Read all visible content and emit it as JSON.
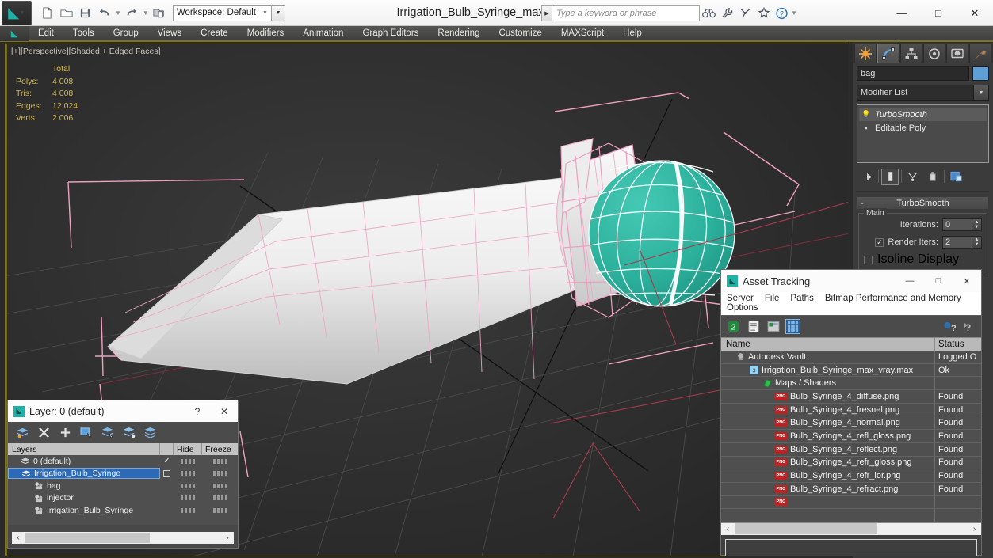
{
  "titlebar": {
    "app_logo": "3dsmax-logo-icon",
    "quick_access": [
      {
        "name": "new-file-icon",
        "glyph": "⬜"
      },
      {
        "name": "open-file-icon",
        "glyph": "🗁"
      },
      {
        "name": "save-file-icon",
        "glyph": "💾"
      },
      {
        "name": "undo-icon",
        "glyph": "↶"
      },
      {
        "name": "redo-icon",
        "glyph": "↷"
      },
      {
        "name": "project-folder-icon",
        "glyph": "🗂"
      }
    ],
    "workspace_label": "Workspace: Default",
    "document_title": "Irrigation_Bulb_Syringe_max_vray.max",
    "search_placeholder": "Type a keyword or phrase",
    "help_icons": [
      {
        "name": "binoculars-icon",
        "glyph": "🔍"
      },
      {
        "name": "wrench-icon",
        "glyph": "🔧"
      },
      {
        "name": "satellite-icon",
        "glyph": "📡"
      },
      {
        "name": "star-icon",
        "glyph": "★"
      },
      {
        "name": "help-circle-icon",
        "glyph": "?"
      }
    ],
    "window_controls": {
      "minimize": "—",
      "maximize": "□",
      "close": "✕"
    }
  },
  "menubar": {
    "items": [
      "Edit",
      "Tools",
      "Group",
      "Views",
      "Create",
      "Modifiers",
      "Animation",
      "Graph Editors",
      "Rendering",
      "Customize",
      "MAXScript",
      "Help"
    ]
  },
  "viewport": {
    "label": "[+][Perspective][Shaded + Edged Faces]",
    "stats": {
      "header": "Total",
      "rows": [
        {
          "label": "Polys:",
          "value": "4 008"
        },
        {
          "label": "Tris:",
          "value": "4 008"
        },
        {
          "label": "Edges:",
          "value": "12 024"
        },
        {
          "label": "Verts:",
          "value": "2 006"
        }
      ]
    },
    "colors": {
      "sphere": "#2fb5a0",
      "sphere_wire": "#ffffff",
      "body": "#e8e8e8",
      "selection_pink": "#ef9fc0",
      "grid": "#4a4a4a",
      "axis_black": "#111111",
      "axis_red": "#8e3044",
      "background": "#303030"
    }
  },
  "command_panel": {
    "tabs": [
      {
        "name": "create-tab",
        "glyph": "✦",
        "active": false
      },
      {
        "name": "modify-tab",
        "glyph": "◜",
        "active": true
      },
      {
        "name": "hierarchy-tab",
        "glyph": "⛓",
        "active": false
      },
      {
        "name": "motion-tab",
        "glyph": "◎",
        "active": false
      },
      {
        "name": "display-tab",
        "glyph": "▣",
        "active": false
      },
      {
        "name": "utilities-tab",
        "glyph": "🔨",
        "active": false
      }
    ],
    "object_name": "bag",
    "object_color": "#5f9fd8",
    "modifier_list_label": "Modifier List",
    "modifier_stack": [
      {
        "label": "TurboSmooth",
        "icon": "lightbulb-icon",
        "selected": true
      },
      {
        "label": "Editable Poly",
        "icon": "plus-box-icon",
        "selected": false
      }
    ],
    "stack_buttons": [
      {
        "name": "pin-stack-button",
        "glyph": "⚐"
      },
      {
        "name": "show-end-result-button",
        "glyph": "❙"
      },
      {
        "name": "make-unique-button",
        "glyph": "⑂"
      },
      {
        "name": "remove-modifier-button",
        "glyph": "⛃"
      },
      {
        "name": "configure-modifier-sets-button",
        "glyph": "▥"
      }
    ],
    "rollout": {
      "title": "TurboSmooth",
      "collapse_glyph": "-",
      "group_label": "Main",
      "iterations_label": "Iterations:",
      "iterations_value": "0",
      "render_iters_label": "Render Iters:",
      "render_iters_value": "2",
      "render_iters_checked": true,
      "isoline_label": "Isoline Display",
      "isoline_checked": false
    }
  },
  "asset_tracking": {
    "title": "Asset Tracking",
    "window_controls": {
      "minimize": "—",
      "maximize": "□",
      "close": "✕"
    },
    "menu": [
      "Server",
      "File",
      "Paths",
      "Bitmap Performance and Memory",
      "Options"
    ],
    "toolbar": [
      {
        "name": "vault-refresh-icon",
        "glyph": "↻",
        "active": false
      },
      {
        "name": "list-view-icon",
        "glyph": "☰",
        "active": false
      },
      {
        "name": "detail-view-icon",
        "glyph": "⊞",
        "active": false
      },
      {
        "name": "grid-view-icon",
        "glyph": "▦",
        "active": true
      },
      {
        "name": "help-assets-icon",
        "glyph": "?",
        "active": false
      },
      {
        "name": "help-context-icon",
        "glyph": "?",
        "active": false
      }
    ],
    "columns": {
      "name": "Name",
      "status": "Status"
    },
    "rows": [
      {
        "name": "Autodesk Vault",
        "status": "Logged O",
        "indent": 0,
        "icon": "vault-icon"
      },
      {
        "name": "Irrigation_Bulb_Syringe_max_vray.max",
        "status": "Ok",
        "indent": 1,
        "icon": "max-file-icon"
      },
      {
        "name": "Maps / Shaders",
        "status": "",
        "indent": 2,
        "icon": "maps-icon"
      },
      {
        "name": "Bulb_Syringe_4_diffuse.png",
        "status": "Found",
        "indent": 3,
        "icon": "png-icon"
      },
      {
        "name": "Bulb_Syringe_4_fresnel.png",
        "status": "Found",
        "indent": 3,
        "icon": "png-icon"
      },
      {
        "name": "Bulb_Syringe_4_normal.png",
        "status": "Found",
        "indent": 3,
        "icon": "png-icon"
      },
      {
        "name": "Bulb_Syringe_4_refl_gloss.png",
        "status": "Found",
        "indent": 3,
        "icon": "png-icon"
      },
      {
        "name": "Bulb_Syringe_4_reflect.png",
        "status": "Found",
        "indent": 3,
        "icon": "png-icon"
      },
      {
        "name": "Bulb_Syringe_4_refr_gloss.png",
        "status": "Found",
        "indent": 3,
        "icon": "png-icon"
      },
      {
        "name": "Bulb_Syringe_4_refr_ior.png",
        "status": "Found",
        "indent": 3,
        "icon": "png-icon"
      },
      {
        "name": "Bulb_Syringe_4_refract.png",
        "status": "Found",
        "indent": 3,
        "icon": "png-icon"
      }
    ],
    "scroll_arrows": {
      "left": "‹",
      "right": "›"
    }
  },
  "layer_dialog": {
    "title": "Layer: 0 (default)",
    "help_glyph": "?",
    "close_glyph": "✕",
    "toolbar": [
      {
        "name": "set-current-layer-icon",
        "glyph": "≡"
      },
      {
        "name": "delete-layer-icon",
        "glyph": "✕"
      },
      {
        "name": "new-layer-icon",
        "glyph": "＋"
      },
      {
        "name": "add-selection-to-layer-icon",
        "glyph": "▤"
      },
      {
        "name": "select-objects-in-layer-icon",
        "glyph": "▥"
      },
      {
        "name": "highlight-selected-objects-icon",
        "glyph": "▦"
      },
      {
        "name": "hide-unselected-layers-icon",
        "glyph": "▧"
      }
    ],
    "columns": {
      "layers": "Layers",
      "hide": "Hide",
      "freeze": "Freeze"
    },
    "rows": [
      {
        "name": "0 (default)",
        "indent": 0,
        "selected": false,
        "current": true,
        "icon": "layer-icon"
      },
      {
        "name": "Irrigation_Bulb_Syringe",
        "indent": 0,
        "selected": true,
        "current": false,
        "icon": "layer-icon"
      },
      {
        "name": "bag",
        "indent": 1,
        "selected": false,
        "current": false,
        "icon": "object-icon"
      },
      {
        "name": "injector",
        "indent": 1,
        "selected": false,
        "current": false,
        "icon": "object-icon"
      },
      {
        "name": "Irrigation_Bulb_Syringe",
        "indent": 1,
        "selected": false,
        "current": false,
        "icon": "object-icon"
      }
    ],
    "scroll_arrows": {
      "left": "‹",
      "right": "›"
    }
  }
}
